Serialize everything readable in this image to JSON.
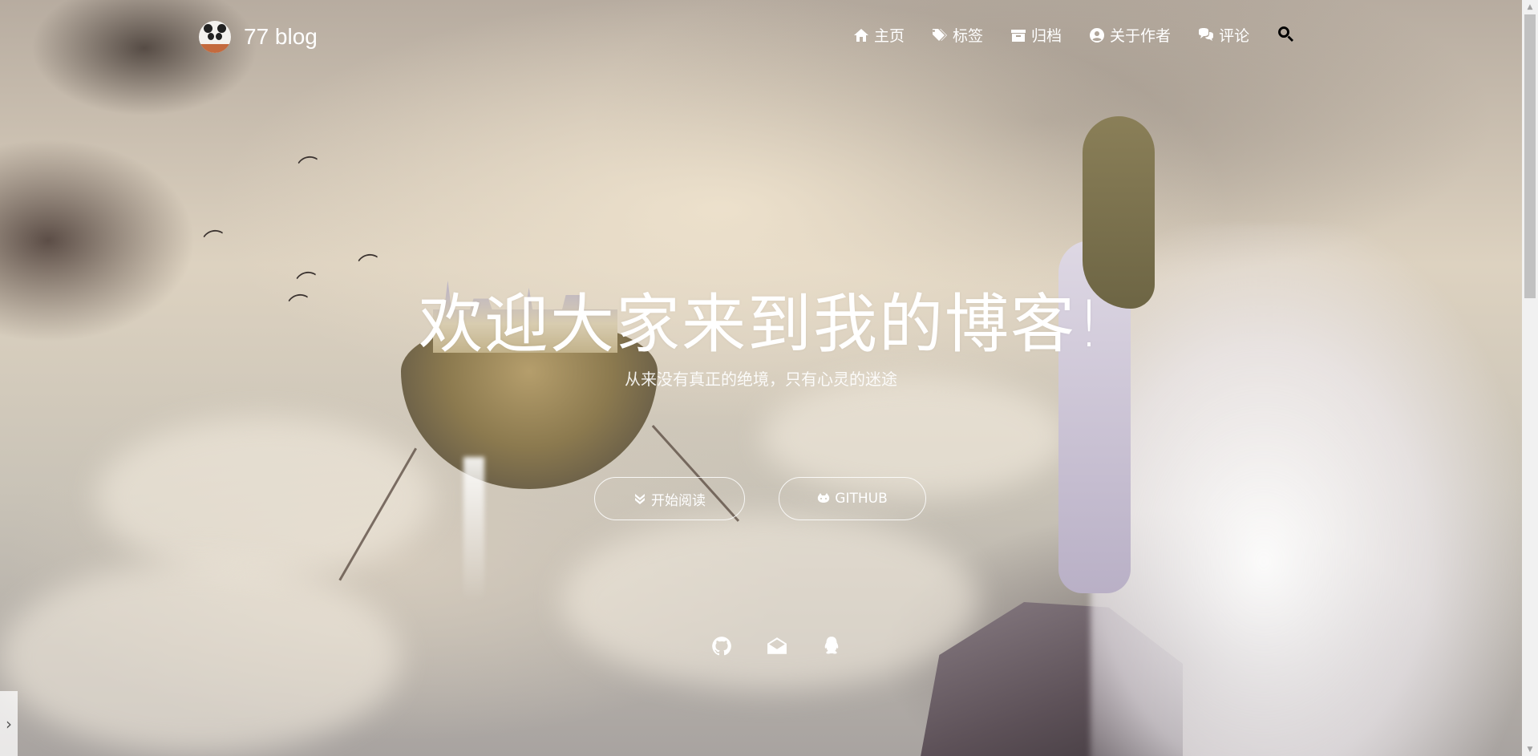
{
  "brand": {
    "name": "77 blog"
  },
  "nav": {
    "items": [
      {
        "label": "主页",
        "icon": "home-icon"
      },
      {
        "label": "标签",
        "icon": "tags-icon"
      },
      {
        "label": "归档",
        "icon": "archive-icon"
      },
      {
        "label": "关于作者",
        "icon": "user-circle-icon"
      },
      {
        "label": "评论",
        "icon": "comments-icon"
      }
    ],
    "search_icon": "search-icon"
  },
  "hero": {
    "title": "欢迎大家来到我的博客!",
    "subtitle": "从来没有真正的绝境，只有心灵的迷途",
    "buttons": {
      "read_label": "开始阅读",
      "github_label": "GITHUB"
    }
  },
  "socials": [
    "github-icon",
    "mail-icon",
    "qq-icon"
  ],
  "colors": {
    "text": "#ffffff",
    "scrollbar_track": "#f1f1f1",
    "scrollbar_thumb": "#c1c1c1"
  }
}
